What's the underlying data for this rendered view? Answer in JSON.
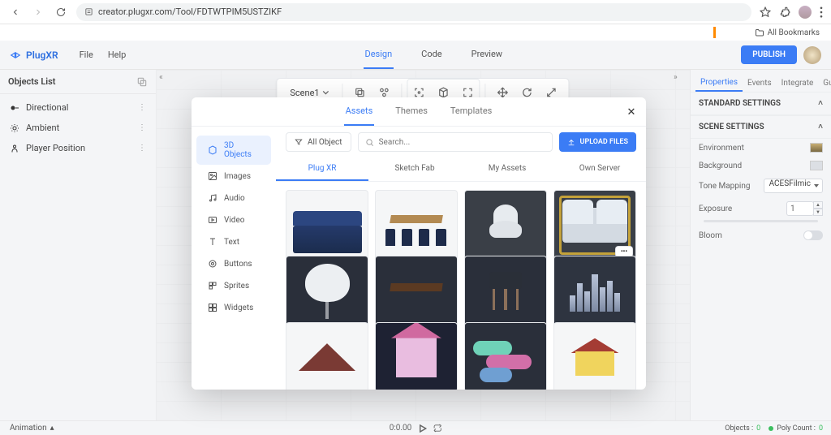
{
  "browser": {
    "url": "creator.plugxr.com/Tool/FDTWTPIM5USTZIKF",
    "bookmarks_label": "All Bookmarks"
  },
  "brand": "PlugXR",
  "menubar": [
    "File",
    "Help"
  ],
  "center_tabs": {
    "items": [
      "Design",
      "Code",
      "Preview"
    ],
    "active": 0
  },
  "publish_label": "PUBLISH",
  "scene_dropdown": "Scene1",
  "left_panel": {
    "title": "Objects List",
    "items": [
      {
        "label": "Directional"
      },
      {
        "label": "Ambient"
      },
      {
        "label": "Player Position"
      }
    ]
  },
  "right_panel": {
    "tabs": [
      "Properties",
      "Events",
      "Integrate",
      "Guide"
    ],
    "active_tab": 0,
    "sections": {
      "standard_title": "STANDARD SETTINGS",
      "scene_title": "SCENE SETTINGS",
      "environment_label": "Environment",
      "background_label": "Background",
      "tone_mapping_label": "Tone Mapping",
      "tone_mapping_value": "ACESFilmic",
      "exposure_label": "Exposure",
      "exposure_value": "1",
      "bloom_label": "Bloom"
    }
  },
  "footer": {
    "animation_label": "Animation",
    "time": "0:0.00",
    "objects_label": "Objects :",
    "objects_count": "0",
    "polycount_label": "Poly Count :",
    "polycount_value": "0"
  },
  "modal": {
    "tabs": [
      "Assets",
      "Themes",
      "Templates"
    ],
    "active_tab": 0,
    "close": "×",
    "side_items": [
      {
        "label": "3D Objects"
      },
      {
        "label": "Images"
      },
      {
        "label": "Audio"
      },
      {
        "label": "Video"
      },
      {
        "label": "Text"
      },
      {
        "label": "Buttons"
      },
      {
        "label": "Sprites"
      },
      {
        "label": "Widgets"
      }
    ],
    "active_side": 0,
    "filter_label": "All Object",
    "search_placeholder": "Search...",
    "upload_label": "UPLOAD FILES",
    "sub_tabs": [
      "Plug XR",
      "Sketch Fab",
      "My Assets",
      "Own Server"
    ],
    "active_sub": 0
  }
}
